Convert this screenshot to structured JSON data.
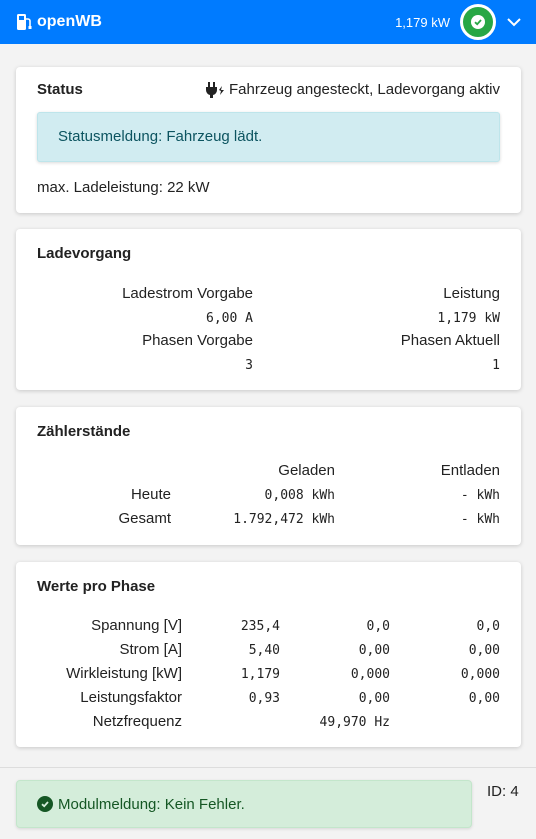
{
  "header": {
    "brand": "openWB",
    "power": "1,179 kW"
  },
  "status_card": {
    "title": "Status",
    "plug_status": "Fahrzeug angesteckt, Ladevorgang aktiv",
    "message": "Statusmeldung: Fahrzeug lädt.",
    "max_power": "max. Ladeleistung: 22 kW"
  },
  "ladevorgang": {
    "title": "Ladevorgang",
    "ladestrom_label": "Ladestrom Vorgabe",
    "ladestrom_value": "6,00 A",
    "leistung_label": "Leistung",
    "leistung_value": "1,179 kW",
    "phasen_vorgabe_label": "Phasen Vorgabe",
    "phasen_vorgabe_value": "3",
    "phasen_aktuell_label": "Phasen Aktuell",
    "phasen_aktuell_value": "1"
  },
  "zaehler": {
    "title": "Zählerstände",
    "col_geladen": "Geladen",
    "col_entladen": "Entladen",
    "rows": [
      {
        "label": "Heute",
        "geladen": "0,008 kWh",
        "entladen": "- kWh"
      },
      {
        "label": "Gesamt",
        "geladen": "1.792,472 kWh",
        "entladen": "- kWh"
      }
    ]
  },
  "phasen": {
    "title": "Werte pro Phase",
    "rows": [
      {
        "label": "Spannung [V]",
        "values": [
          "235,4",
          "0,0",
          "0,0"
        ]
      },
      {
        "label": "Strom [A]",
        "values": [
          "5,40",
          "0,00",
          "0,00"
        ]
      },
      {
        "label": "Wirkleistung [kW]",
        "values": [
          "1,179",
          "0,000",
          "0,000"
        ]
      },
      {
        "label": "Leistungsfaktor",
        "values": [
          "0,93",
          "0,00",
          "0,00"
        ]
      }
    ],
    "frequency_label": "Netzfrequenz",
    "frequency_value": "49,970 Hz"
  },
  "footer": {
    "module_message": "Modulmeldung: Kein Fehler.",
    "id_label": "ID: 4"
  },
  "colors": {
    "header_bg": "#007bff",
    "status_ok": "#28a745",
    "info_bg": "#d1ecf1",
    "success_bg": "#d4edda"
  },
  "icons": [
    "plug-icon",
    "check-circle-icon",
    "chevron-down-icon"
  ]
}
